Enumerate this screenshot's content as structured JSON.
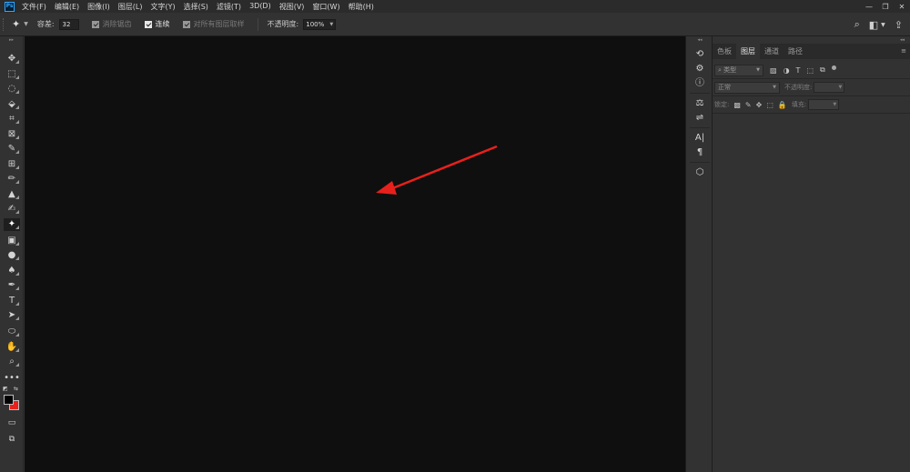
{
  "app": {
    "logo_text": "Ps",
    "menu": [
      "文件(F)",
      "编辑(E)",
      "图像(I)",
      "图层(L)",
      "文字(Y)",
      "选择(S)",
      "滤镜(T)",
      "3D(D)",
      "视图(V)",
      "窗口(W)",
      "帮助(H)"
    ],
    "window_controls": {
      "minimize": "—",
      "restore": "❐",
      "close": "✕"
    }
  },
  "options_bar": {
    "tool_icon": "magic-wand-icon",
    "tolerance_label": "容差:",
    "tolerance_value": "32",
    "anti_alias_label": "消除锯齿",
    "contiguous_label": "连续",
    "sample_all_layers_label": "对所有图层取样",
    "opacity_label": "不透明度:",
    "opacity_value": "100%"
  },
  "toolbar": {
    "collapse": "▸▸",
    "tools": [
      "✥",
      "⬚",
      "◌",
      "⬙",
      "⌗",
      "⊠",
      "✎",
      "⊞",
      "✏",
      "▲",
      "✍",
      "✦",
      "▣",
      "●",
      "♠",
      "✒",
      "T",
      "➤",
      "⬭",
      "✋",
      "⌕",
      "•••"
    ],
    "active_index": 11,
    "foreground_color": "#000000",
    "background_color": "#e8201c",
    "swap_glyph": "⇆",
    "default_glyph": "◩"
  },
  "dock": {
    "collapse": "◂◂",
    "groups": [
      [
        "⟲",
        "⚙",
        "ⓘ"
      ],
      [
        "⚖",
        "⇌"
      ],
      [
        "A|",
        "¶"
      ],
      [
        "⬡"
      ]
    ]
  },
  "layers_panel": {
    "collapse": "◂◂",
    "tabs": [
      "色板",
      "图层",
      "通道",
      "路径"
    ],
    "active_tab": 1,
    "menu_glyph": "≡",
    "kind_label": "类型",
    "kind_icon": "⌕",
    "filter_icons": [
      "▨",
      "◑",
      "T",
      "⬚",
      "⧉"
    ],
    "blend_mode": "正常",
    "opacity_label": "不透明度:",
    "lock_label": "锁定:",
    "lock_icons": [
      "▩",
      "✎",
      "✥",
      "⬚",
      "🔒"
    ],
    "fill_label": "填充:"
  },
  "annotation": {
    "arrow_color": "#e8201c"
  }
}
